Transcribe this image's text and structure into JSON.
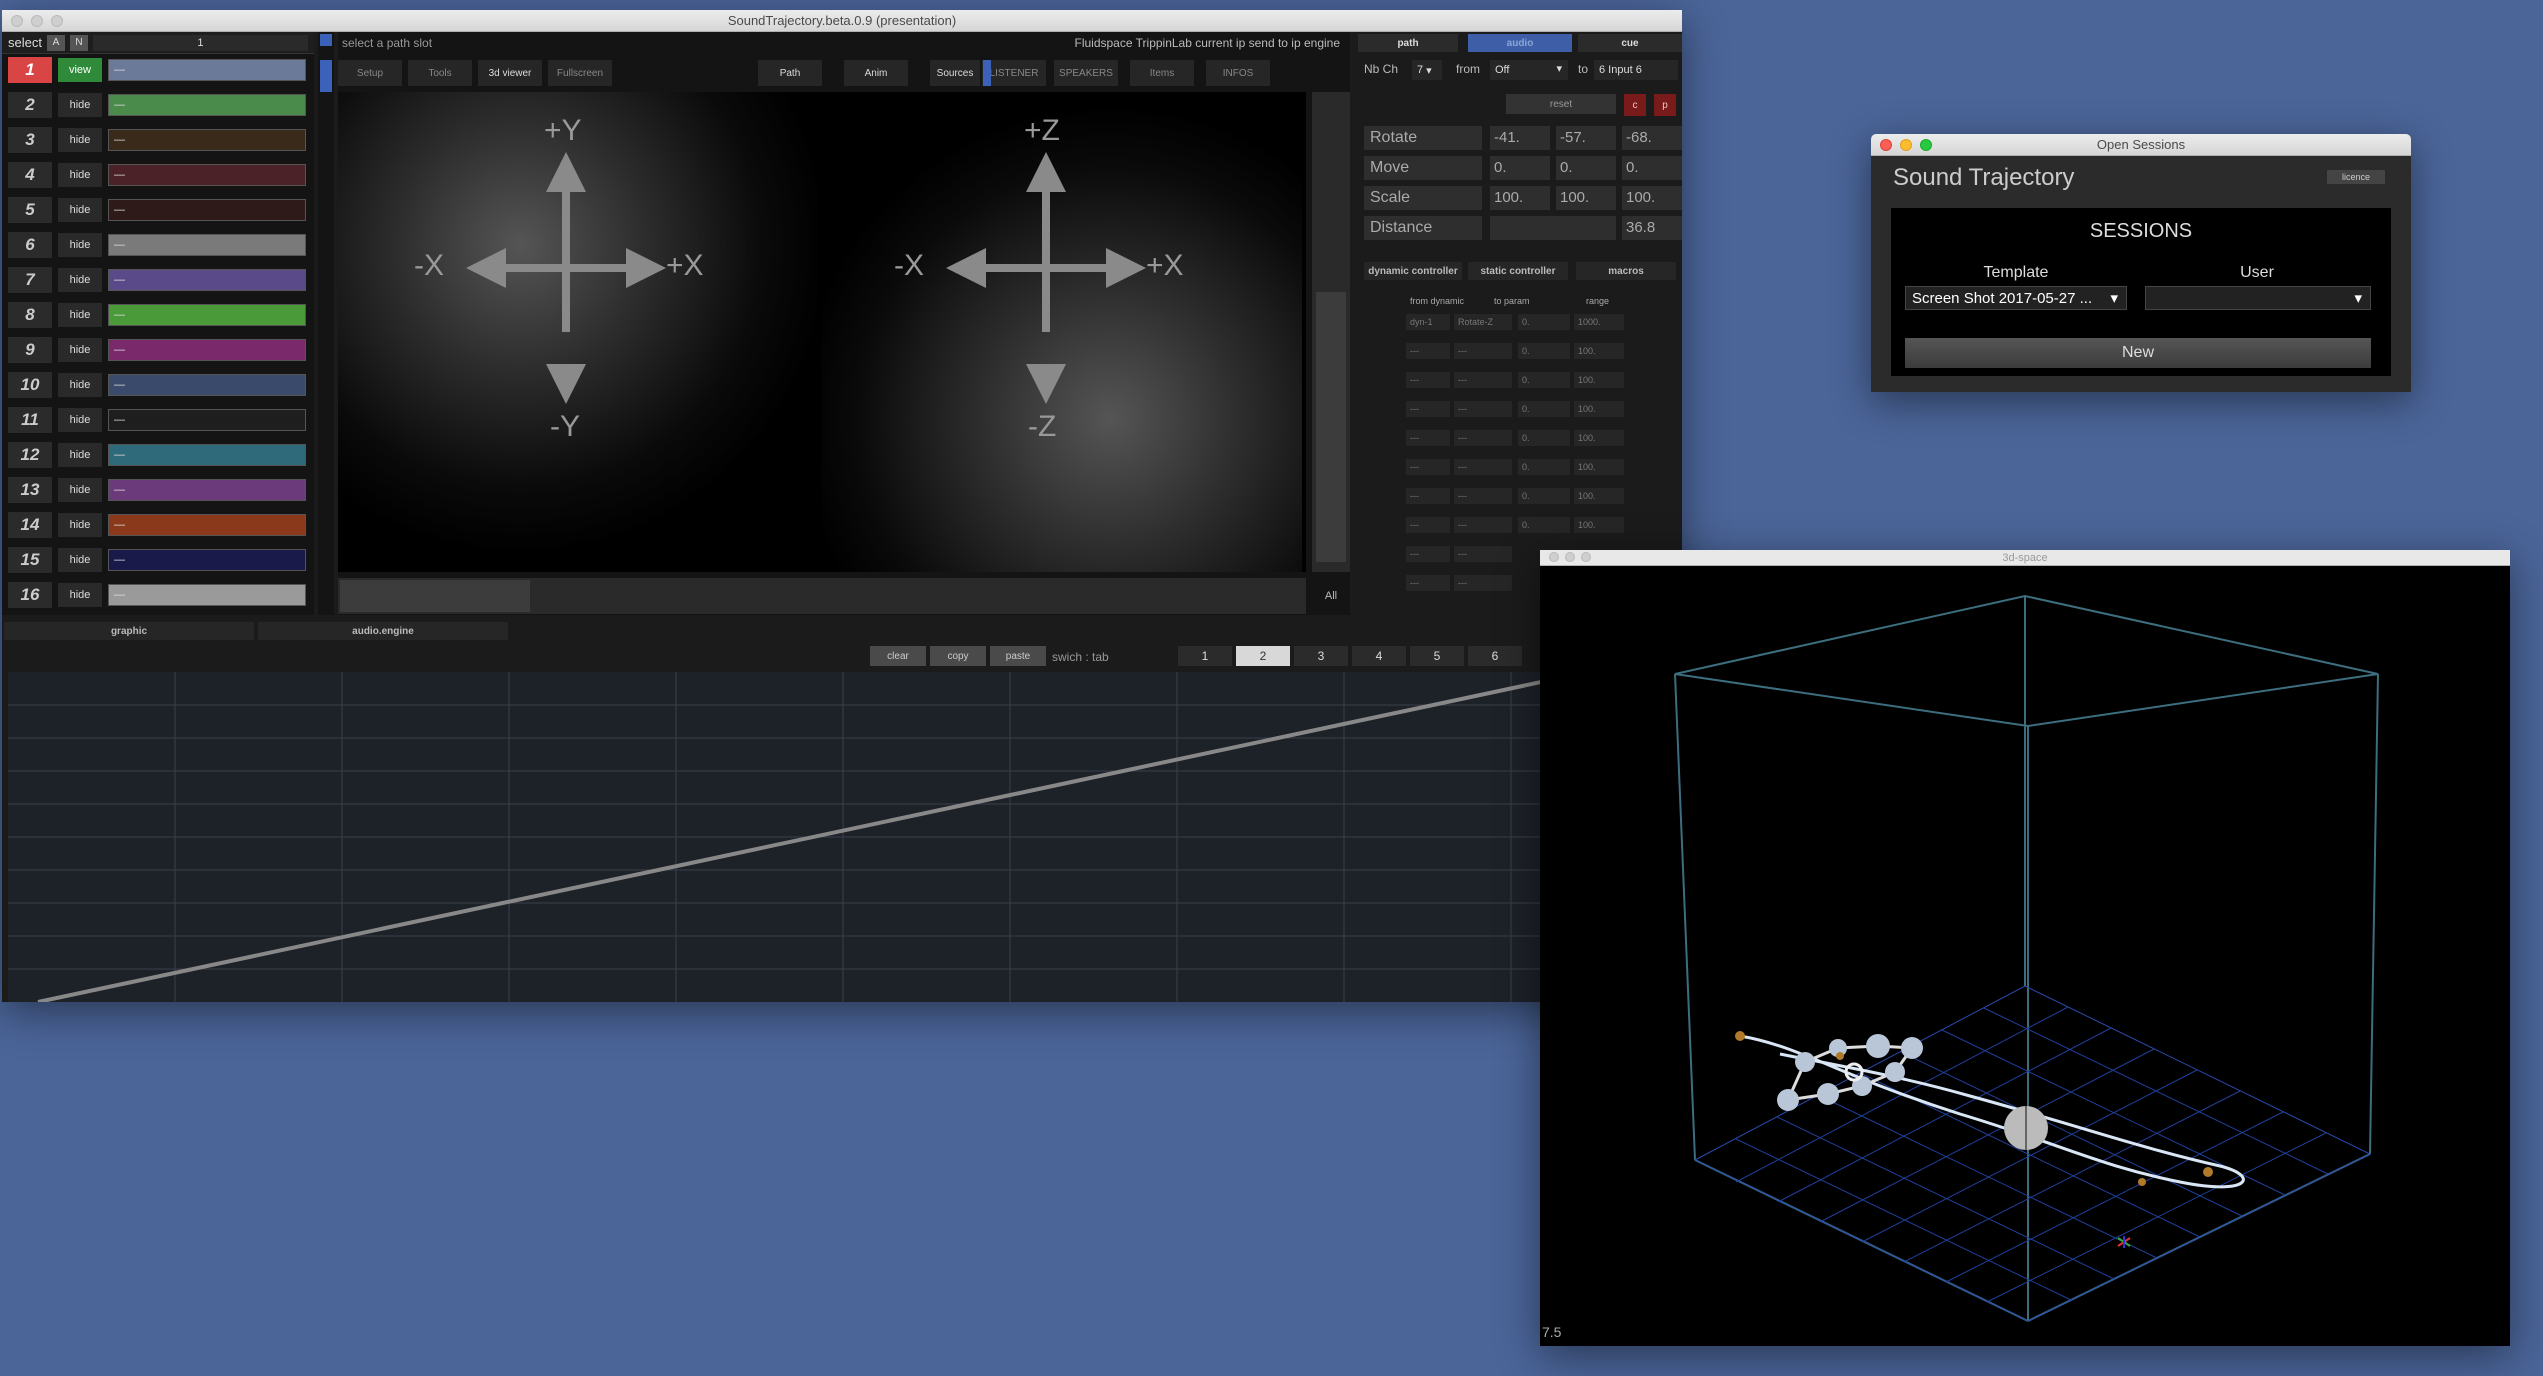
{
  "main": {
    "title": "SoundTrajectory.beta.0.9 (presentation)",
    "select_label": "select",
    "select_a": "A",
    "select_n": "N",
    "select_num": "1",
    "hint": "select a path slot",
    "info": "Fluidspace TrippinLab current ip send to ip engine",
    "tabs": [
      "Setup",
      "Tools",
      "3d viewer",
      "Fullscreen",
      "Path",
      "Anim",
      "Sources",
      "LISTENER",
      "SPEAKERS",
      "Items",
      "INFOS"
    ],
    "slots": [
      {
        "n": "1",
        "vis": "view",
        "color": "#6b7a99",
        "active": true
      },
      {
        "n": "2",
        "vis": "hide",
        "color": "#4a8a4a"
      },
      {
        "n": "3",
        "vis": "hide",
        "color": "#3a2a1a"
      },
      {
        "n": "4",
        "vis": "hide",
        "color": "#4a2228"
      },
      {
        "n": "5",
        "vis": "hide",
        "color": "#2e1a18"
      },
      {
        "n": "6",
        "vis": "hide",
        "color": "#7a7a7a"
      },
      {
        "n": "7",
        "vis": "hide",
        "color": "#5a4a8a"
      },
      {
        "n": "8",
        "vis": "hide",
        "color": "#4a9a3a"
      },
      {
        "n": "9",
        "vis": "hide",
        "color": "#7a2a6a"
      },
      {
        "n": "10",
        "vis": "hide",
        "color": "#3a4a6a"
      },
      {
        "n": "11",
        "vis": "hide",
        "color": "#1e1e1e"
      },
      {
        "n": "12",
        "vis": "hide",
        "color": "#2e6a7a"
      },
      {
        "n": "13",
        "vis": "hide",
        "color": "#6a3a7a"
      },
      {
        "n": "14",
        "vis": "hide",
        "color": "#8a3a1a"
      },
      {
        "n": "15",
        "vis": "hide",
        "color": "#1a1a4a"
      },
      {
        "n": "16",
        "vis": "hide",
        "color": "#9a9a9a"
      }
    ],
    "slot_text": "—",
    "axes": {
      "py": "+Y",
      "ny": "-Y",
      "nx": "-X",
      "px": "+X",
      "pz": "+Z",
      "nz": "-Z"
    },
    "all_label": "All",
    "right": {
      "seg": [
        "path",
        "audio",
        "cue"
      ],
      "nbch_label": "Nb Ch",
      "nbch_value": "7",
      "from_label": "from",
      "from_value": "Off",
      "to_label": "to",
      "to_value": "6 Input 6",
      "reset": "reset",
      "c": "c",
      "p": "p",
      "params": [
        {
          "label": "Rotate",
          "v": [
            "-41.",
            "-57.",
            "-68."
          ]
        },
        {
          "label": "Move",
          "v": [
            "0.",
            "0.",
            "0."
          ]
        },
        {
          "label": "Scale",
          "v": [
            "100.",
            "100.",
            "100."
          ]
        },
        {
          "label": "Distance",
          "v": [
            "",
            "",
            "36.8"
          ]
        }
      ],
      "ctl_tabs": [
        "dynamic controller",
        "static controller",
        "macros"
      ],
      "ctl_head": [
        "from dynamic",
        "to param",
        "range"
      ],
      "first_row": {
        "a": "dyn-1",
        "b": "Rotate-Z",
        "c": "0.",
        "d": "1000."
      },
      "dash": "---",
      "zero": "0.",
      "hundred": "100."
    },
    "lower_tabs": [
      "graphic",
      "audio.engine"
    ],
    "tools": [
      "clear",
      "copy",
      "paste"
    ],
    "switch": "swich : tab",
    "pages": [
      "1",
      "2",
      "3",
      "4",
      "5",
      "6"
    ],
    "selected_page": "2"
  },
  "sessions": {
    "window_title": "Open Sessions",
    "title": "Sound Trajectory",
    "licence": "licence",
    "heading": "SESSIONS",
    "template_label": "Template",
    "user_label": "User",
    "template_value": "Screen Shot 2017-05-27 ...",
    "user_value": "",
    "new": "New"
  },
  "space": {
    "window_title": "3d-space",
    "zoom": "7.5"
  }
}
